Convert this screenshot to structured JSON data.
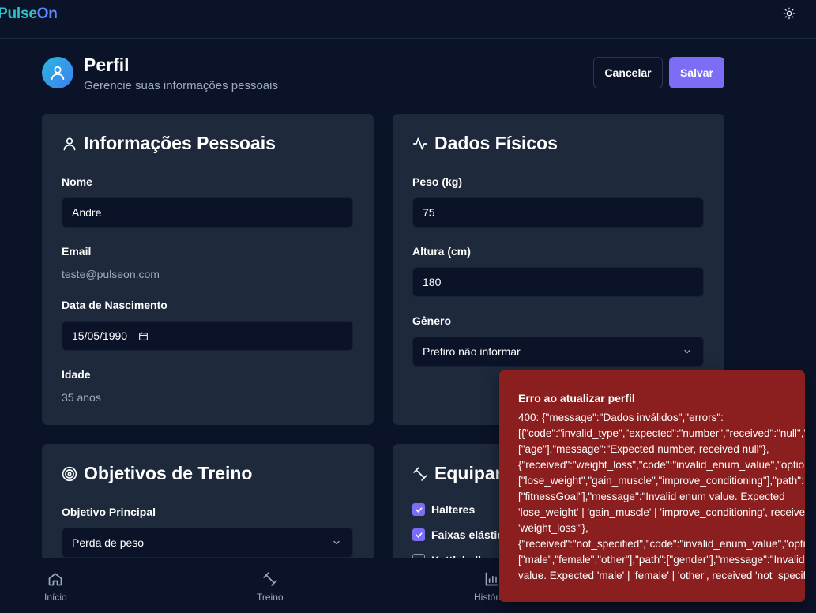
{
  "app": {
    "logo_part1": "Pulse",
    "logo_part2": "On"
  },
  "header": {
    "title": "Perfil",
    "subtitle": "Gerencie suas informações pessoais",
    "cancel_label": "Cancelar",
    "save_label": "Salvar"
  },
  "personal": {
    "title": "Informações Pessoais",
    "name_label": "Nome",
    "name_value": "Andre",
    "email_label": "Email",
    "email_value": "teste@pulseon.com",
    "birth_label": "Data de Nascimento",
    "birth_value": "15/05/1990",
    "age_label": "Idade",
    "age_value": "35 anos"
  },
  "physical": {
    "title": "Dados Físicos",
    "weight_label": "Peso (kg)",
    "weight_value": "75",
    "height_label": "Altura (cm)",
    "height_value": "180",
    "gender_label": "Gênero",
    "gender_value": "Prefiro não informar"
  },
  "goals": {
    "title": "Objetivos de Treino",
    "main_goal_label": "Objetivo Principal",
    "main_goal_value": "Perda de peso"
  },
  "equipment": {
    "title": "Equipamentos",
    "items": [
      {
        "label": "Halteres",
        "checked": true
      },
      {
        "label": "Faixas elásticas",
        "checked": true
      },
      {
        "label": "Kettlebell",
        "checked": false
      }
    ]
  },
  "nav": {
    "items": [
      {
        "label": "Início",
        "icon": "home-icon"
      },
      {
        "label": "Treino",
        "icon": "dumbbell-icon"
      },
      {
        "label": "Histórico",
        "icon": "chart-icon"
      }
    ]
  },
  "toast": {
    "title": "Erro ao atualizar perfil",
    "lines": [
      "400: {\"message\":\"Dados inválidos\",\"errors\":",
      "[{\"code\":\"invalid_type\",\"expected\":\"number\",\"received\":\"null\",\"path\":",
      "[\"age\"],\"message\":\"Expected number, received null\"},",
      "{\"received\":\"weight_loss\",\"code\":\"invalid_enum_value\",\"options\":",
      "[\"lose_weight\",\"gain_muscle\",\"improve_conditioning\"],\"path\":",
      "[\"fitnessGoal\"],\"message\":\"Invalid enum value. Expected",
      "'lose_weight' | 'gain_muscle' | 'improve_conditioning', received",
      "'weight_loss'\"},",
      "{\"received\":\"not_specified\",\"code\":\"invalid_enum_value\",\"options\":",
      "[\"male\",\"female\",\"other\"],\"path\":[\"gender\"],\"message\":\"Invalid enum",
      "value. Expected 'male' | 'female' | 'other', received 'not_specified'\"}"
    ]
  },
  "colors": {
    "background": "#0b1329",
    "card": "#1e293b",
    "accent": "#7c6cf6",
    "error": "#8b1e1e"
  }
}
